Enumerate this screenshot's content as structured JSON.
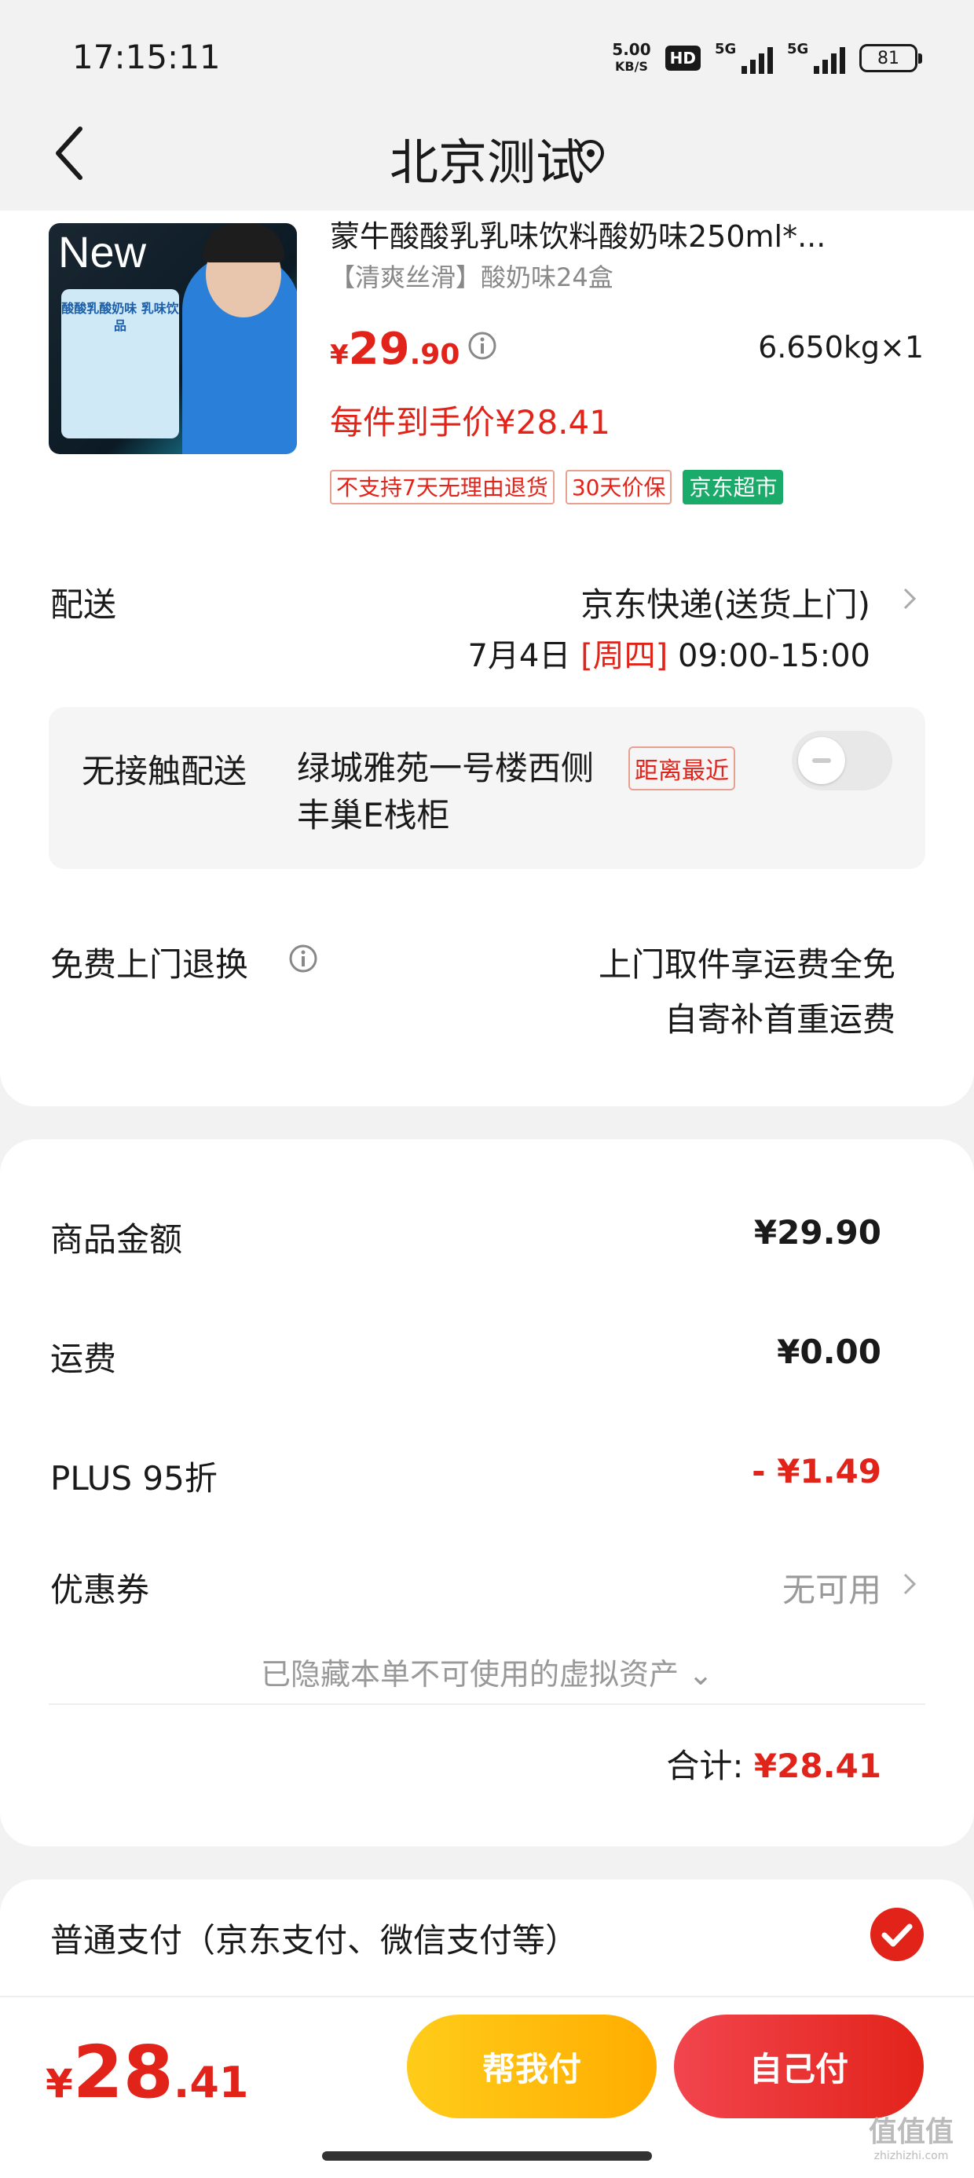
{
  "status_bar": {
    "time": "17:15:11",
    "net_speed_value": "5.00",
    "net_speed_unit": "KB/S",
    "hd_label": "HD",
    "sim1_label": "5G",
    "sim2_label": "5G",
    "battery": "81"
  },
  "header": {
    "title": "北京测试",
    "back_icon": "chevron-left-icon",
    "location_icon": "location-pin-icon"
  },
  "product": {
    "title": "蒙牛酸酸乳乳味饮料酸奶味250ml*...",
    "subtitle": "【清爽丝滑】酸奶味24盒",
    "image_text_new": "New",
    "image_text_box": "酸酸乳酸奶味 乳味饮品",
    "price_symbol": "¥",
    "price_int": "29",
    "price_dec": ".90",
    "weight": "6.650kg×1",
    "per_item_price": "每件到手价¥28.41",
    "tags": [
      "不支持7天无理由退货",
      "30天价保",
      "京东超市"
    ]
  },
  "delivery": {
    "label": "配送",
    "method": "京东快递(送货上门)",
    "date": "7月4日",
    "weekday": "[周四]",
    "time_range": "09:00-15:00",
    "contactless_label": "无接触配送",
    "contactless_address": "绿城雅苑一号楼西侧丰巢E栈柜",
    "contactless_badge": "距离最近",
    "contactless_enabled": false
  },
  "returns": {
    "label": "免费上门退换",
    "line1": "上门取件享运费全免",
    "line2": "自寄补首重运费"
  },
  "summary": {
    "goods_label": "商品金额",
    "goods_value": "¥29.90",
    "shipping_label": "运费",
    "shipping_value": "¥0.00",
    "plus_label": "PLUS 95折",
    "plus_value": "- ¥1.49",
    "coupon_label": "优惠券",
    "coupon_value": "无可用",
    "hidden_assets": "已隐藏本单不可使用的虚拟资产 ⌄",
    "total_label": "合计:",
    "total_value": "¥28.41"
  },
  "payment": {
    "method": "普通支付（京东支付、微信支付等）",
    "selected": true
  },
  "bottom_bar": {
    "price_symbol": "¥",
    "price_int": "28",
    "price_dec": ".41",
    "help_pay": "帮我付",
    "self_pay": "自己付"
  },
  "watermark": {
    "text": "值值值",
    "sub": "zhizhizhi.com"
  },
  "colors": {
    "accent_red": "#e2231a",
    "help_yellow": "#ffbb0a",
    "jd_green": "#1aaa6a"
  }
}
